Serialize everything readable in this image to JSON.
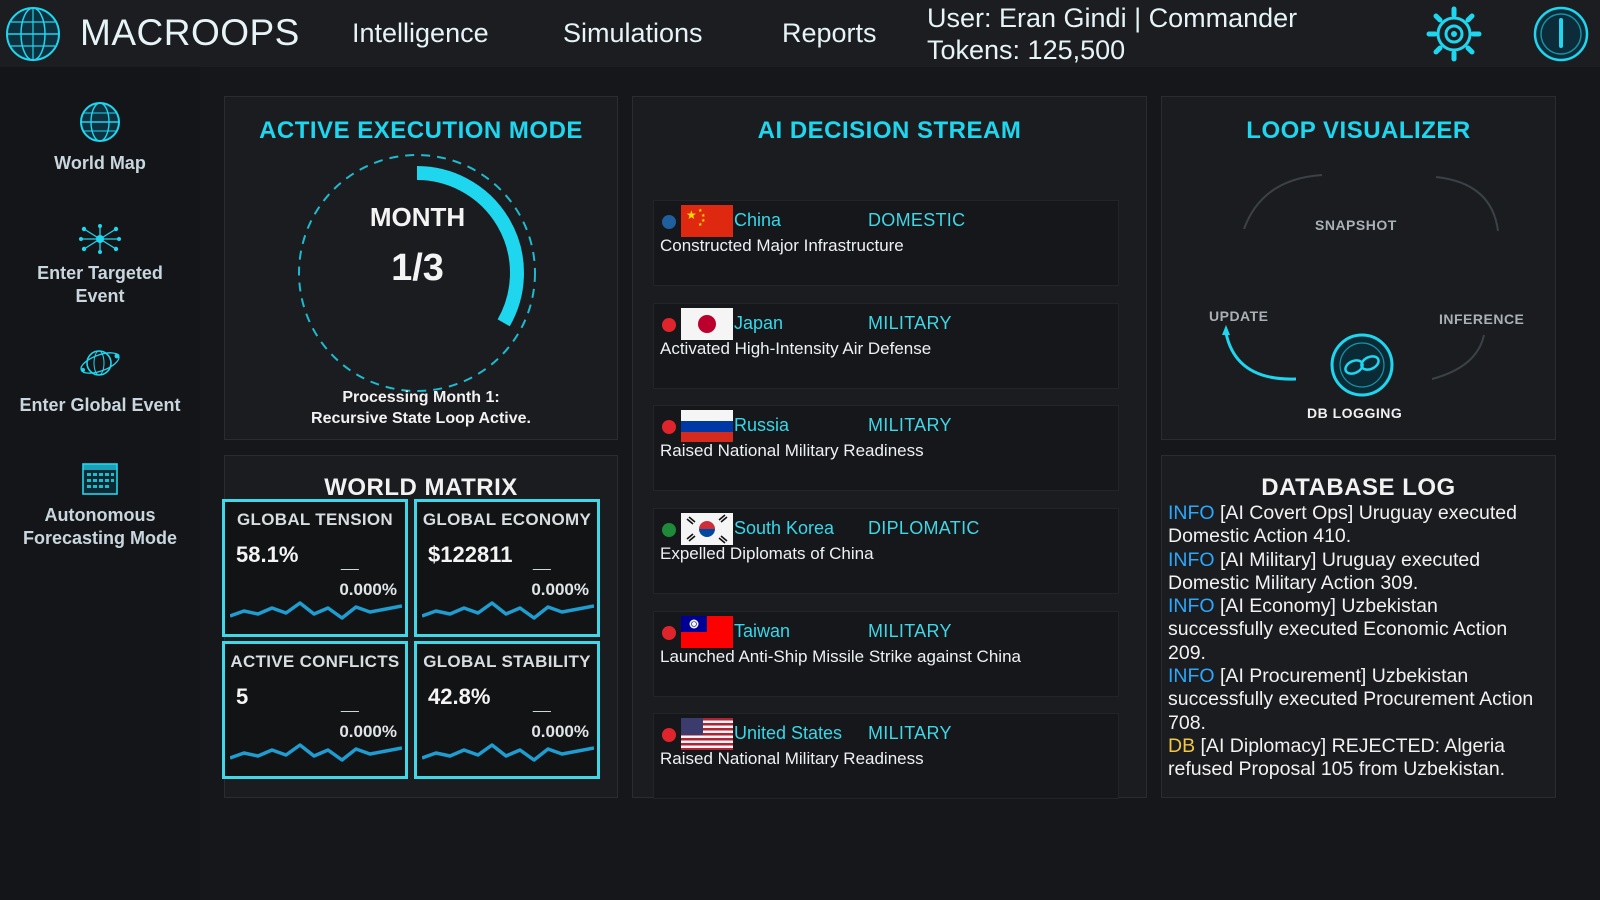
{
  "header": {
    "brand": "MACROOPS",
    "nav": [
      "Intelligence",
      "Simulations",
      "Reports"
    ],
    "user": "User: Eran Gindi | Commander",
    "tokens": "Tokens: 125,500",
    "icons": {
      "logo": "globe-icon",
      "settings": "gear-icon",
      "power": "power-icon"
    }
  },
  "sidebar": {
    "items": [
      {
        "label": "World Map",
        "icon": "globe-icon"
      },
      {
        "label": "Enter Targeted Event",
        "icon": "network-icon"
      },
      {
        "label": "Enter Global Event",
        "icon": "orbit-icon"
      },
      {
        "label": "Autonomous Forecasting Mode",
        "icon": "calendar-icon"
      }
    ]
  },
  "execution": {
    "title": "ACTIVE EXECUTION MODE",
    "month_label": "MONTH",
    "month_value": "1/3",
    "progress_fraction": 0.333,
    "status_line1": "Processing Month 1:",
    "status_line2": "Recursive State Loop Active."
  },
  "world_matrix": {
    "title": "WORLD MATRIX",
    "metrics": [
      {
        "label": "GLOBAL TENSION",
        "value": "58.1%",
        "dash": "__",
        "change": "0.000%"
      },
      {
        "label": "GLOBAL ECONOMY",
        "value": "$122811",
        "dash": "__",
        "change": "0.000%"
      },
      {
        "label": "ACTIVE CONFLICTS",
        "value": "5",
        "dash": "__",
        "change": "0.000%"
      },
      {
        "label": "GLOBAL STABILITY",
        "value": "42.8%",
        "dash": "__",
        "change": "0.000%"
      }
    ]
  },
  "decision_stream": {
    "title": "AI DECISION STREAM",
    "entries": [
      {
        "country": "China",
        "type": "DOMESTIC",
        "description": "Constructed Major Infrastructure",
        "dot_color": "#1f5f9e",
        "flag": "china"
      },
      {
        "country": "Japan",
        "type": "MILITARY",
        "description": "Activated High-Intensity Air Defense",
        "dot_color": "#e0242c",
        "flag": "japan"
      },
      {
        "country": "Russia",
        "type": "MILITARY",
        "description": "Raised National Military Readiness",
        "dot_color": "#e0242c",
        "flag": "russia"
      },
      {
        "country": "South Korea",
        "type": "DIPLOMATIC",
        "description": "Expelled Diplomats of China",
        "dot_color": "#1e8a3a",
        "flag": "south-korea"
      },
      {
        "country": "Taiwan",
        "type": "MILITARY",
        "description": "Launched Anti-Ship Missile Strike against China",
        "dot_color": "#e0242c",
        "flag": "taiwan"
      },
      {
        "country": "United States",
        "type": "MILITARY",
        "description": "Raised National Military Readiness",
        "dot_color": "#e0242c",
        "flag": "usa"
      }
    ]
  },
  "loop_visualizer": {
    "title": "LOOP VISUALIZER",
    "stages": {
      "snapshot": "SNAPSHOT",
      "inference": "INFERENCE",
      "db_logging": "DB LOGGING",
      "update": "UPDATE"
    },
    "accent": "#1fd6ef"
  },
  "database_log": {
    "title": "DATABASE LOG",
    "entries": [
      {
        "level": "INFO",
        "message": "[AI Covert Ops] Uruguay executed Domestic Action 410."
      },
      {
        "level": "INFO",
        "message": "[AI Military] Uruguay executed Domestic Military Action 309."
      },
      {
        "level": "INFO",
        "message": "[AI Economy] Uzbekistan successfully executed Economic Action 209."
      },
      {
        "level": "INFO",
        "message": "[AI Procurement] Uzbekistan successfully executed Procurement Action 708."
      },
      {
        "level": "DB",
        "message": "[AI Diplomacy] REJECTED: Algeria refused Proposal 105 from Uzbekistan."
      }
    ]
  },
  "colors": {
    "accent": "#1fd6ef",
    "info": "#2aa8ff",
    "db": "#f2c744",
    "metric_border": "#40d8e6"
  }
}
